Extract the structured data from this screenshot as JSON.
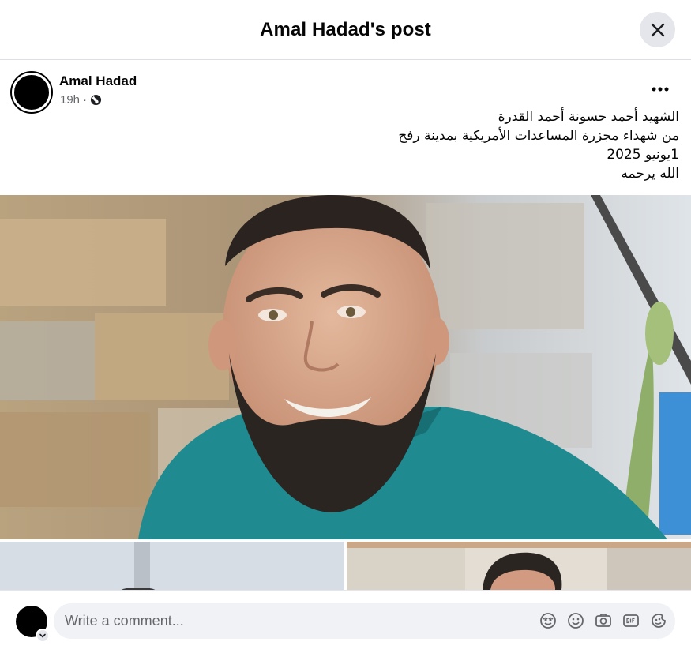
{
  "header": {
    "title": "Amal Hadad's post"
  },
  "post": {
    "author": "Amal Hadad",
    "time": "19h",
    "separator": "·",
    "text_lines": [
      "الشهيد أحمد حسونة أحمد القدرة",
      "من شهداء مجزرة المساعدات الأمريكية بمدينة رفح",
      "1يونيو 2025",
      "الله يرحمه"
    ]
  },
  "comment": {
    "placeholder": "Write a comment..."
  },
  "icons": {
    "close": "close-icon",
    "more": "more-icon",
    "audience": "globe-icon",
    "avatar_menu": "chevron-down-icon",
    "tools": [
      "avatar-sticker-icon",
      "emoji-icon",
      "camera-icon",
      "gif-icon",
      "sticker-icon"
    ]
  },
  "colors": {
    "divider": "#dcdfe3",
    "input_bg": "#f0f2f5",
    "secondary_text": "#65676b",
    "button_bg": "#e4e6eb"
  }
}
